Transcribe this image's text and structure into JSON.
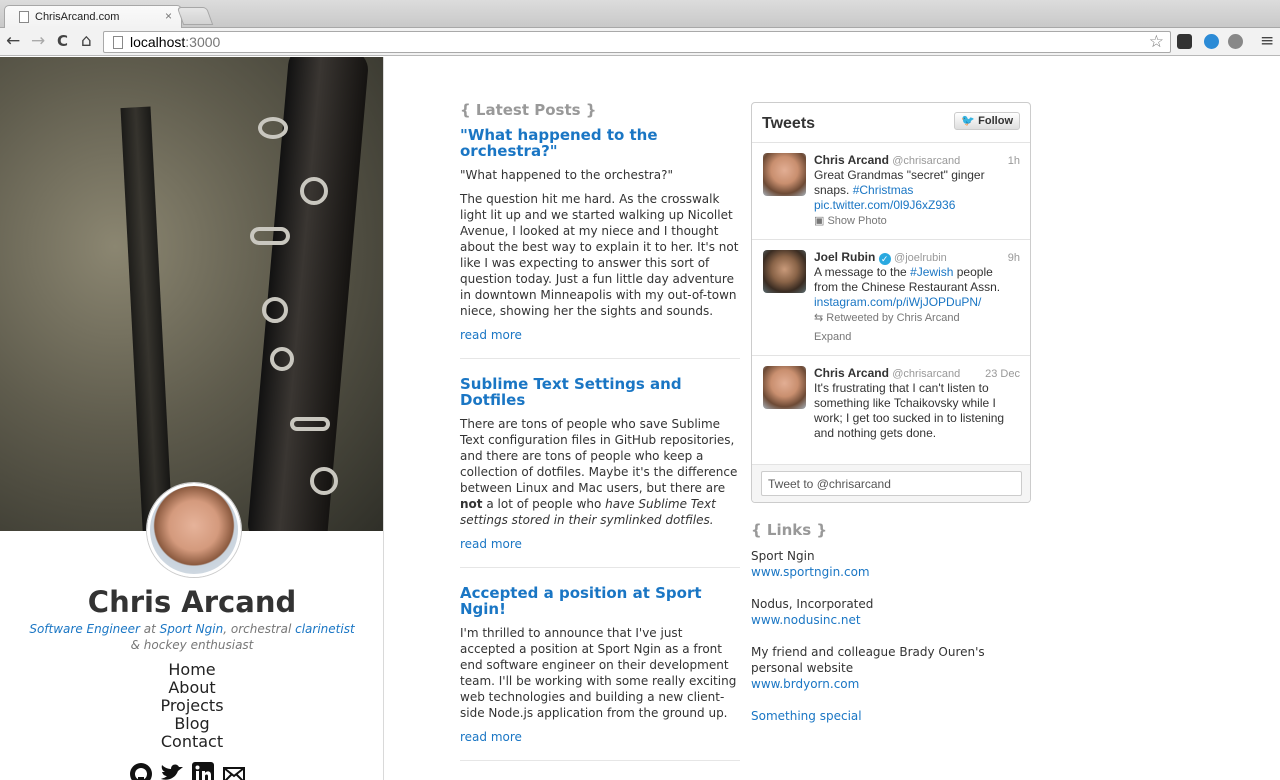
{
  "browser": {
    "tab_title": "ChrisArcand.com",
    "tab_close": "×",
    "url_host": "localhost",
    "url_port": ":3000",
    "back": "←",
    "forward": "→",
    "reload": "C",
    "home": "⌂",
    "menu": "≡",
    "star": "☆"
  },
  "profile": {
    "name": "Chris Arcand",
    "tagline_role": "Software Engineer",
    "tagline_at": " at ",
    "tagline_company": "Sport Ngin",
    "tagline_mid": ", orchestral ",
    "tagline_instrument": "clarinetist",
    "tagline_line2": "& hockey enthusiast"
  },
  "nav": [
    "Home",
    "About",
    "Projects",
    "Blog",
    "Contact"
  ],
  "social_icons": [
    "github-icon",
    "twitter-icon",
    "linkedin-icon",
    "mail-icon"
  ],
  "posts": {
    "heading": "{ Latest Posts }",
    "items": [
      {
        "title": "\"What happened to the orchestra?\"",
        "p1": "\"What happened to the orchestra?\"",
        "p2": "The question hit me hard. As the crosswalk light lit up and we started walking up Nicollet Avenue, I looked at my niece and I thought about the best way to explain it to her. It's not like I was expecting to answer this sort of question today. Just a fun little day adventure in downtown Minneapolis with my out-of-town niece, showing her the sights and sounds.",
        "read_more": "read more"
      },
      {
        "title": "Sublime Text Settings and Dotfiles",
        "p1": "There are tons of people who save Sublime Text configuration files in GitHub repositories, and there are tons of people who keep a collection of dotfiles. Maybe it's the difference between Linux and Mac users, but there are",
        "p1_bold": "not",
        "p1_mid": " a lot of people who ",
        "p1_italic": "have Sublime Text settings stored in their symlinked dotfiles.",
        "read_more": "read more"
      },
      {
        "title": "Accepted a position at Sport Ngin!",
        "p1": "I'm thrilled to announce that I've just accepted a position at Sport Ngin as a front end software engineer on their development team. I'll be working with some really exciting web technologies and building a new client-side Node.js application from the ground up.",
        "read_more": "read more"
      }
    ]
  },
  "twitter": {
    "title": "Tweets",
    "follow": "Follow",
    "input_placeholder": "Tweet to @chrisarcand",
    "tweets": [
      {
        "name": "Chris Arcand",
        "handle": "@chrisarcand",
        "time": "1h",
        "text": "Great Grandmas \"secret\" ginger snaps. ",
        "hashtag": "#Christmas",
        "link": "pic.twitter.com/0l9J6xZ936",
        "meta": "Show Photo"
      },
      {
        "name": "Joel Rubin",
        "handle": "@joelrubin",
        "time": "9h",
        "text_a": "A message to the ",
        "hashtag": "#Jewish",
        "text_b": " people from the Chinese Restaurant Assn. ",
        "link": "instagram.com/p/iWjJOPDuPN/",
        "meta": "Retweeted by Chris Arcand",
        "meta2": "Expand"
      },
      {
        "name": "Chris Arcand",
        "handle": "@chrisarcand",
        "time": "23 Dec",
        "text": "It's frustrating that I can't listen to something like Tchaikovsky while I work; I get too sucked in to listening and nothing gets done."
      }
    ]
  },
  "links": {
    "heading": "{ Links }",
    "items": [
      {
        "label": "Sport Ngin",
        "url": "www.sportngin.com"
      },
      {
        "label": "Nodus, Incorporated",
        "url": "www.nodusinc.net"
      },
      {
        "label": "My friend and colleague Brady Ouren's personal website",
        "url": "www.brdyorn.com"
      }
    ],
    "special": "Something special"
  }
}
